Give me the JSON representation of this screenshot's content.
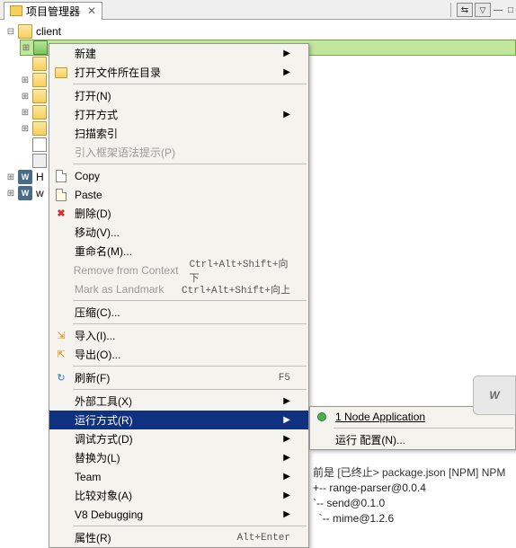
{
  "title": "项目管理器",
  "tree": {
    "root": "client",
    "bottom1": "H",
    "bottom2": "w"
  },
  "menu": {
    "new": "新建",
    "openFolder": "打开文件所在目录",
    "open": "打开(N)",
    "openWith": "打开方式",
    "scanIndex": "扫描索引",
    "importFramework": "引入框架语法提示(P)",
    "copy": "Copy",
    "paste": "Paste",
    "delete": "删除(D)",
    "move": "移动(V)...",
    "rename": "重命名(M)...",
    "removeContext": "Remove from Context",
    "removeContextAccel": "Ctrl+Alt+Shift+向下",
    "markLandmark": "Mark as Landmark",
    "markLandmarkAccel": "Ctrl+Alt+Shift+向上",
    "compress": "压缩(C)...",
    "import": "导入(I)...",
    "export": "导出(O)...",
    "refresh": "刷新(F)",
    "refreshAccel": "F5",
    "extTools": "外部工具(X)",
    "runAs": "运行方式(R)",
    "debugAs": "调试方式(D)",
    "replace": "替换为(L)",
    "team": "Team",
    "compare": "比较对象(A)",
    "v8": "V8 Debugging",
    "properties": "属性(R)",
    "propertiesAccel": "Alt+Enter"
  },
  "submenu": {
    "nodeApp": "1 Node Application",
    "runConfig": "运行 配置(N)..."
  },
  "console": {
    "header": "前是 [已终止> package.json [NPM] NPM",
    "l1": "+-- range-parser@0.0.4",
    "l2": "`-- send@0.1.0",
    "l3": "  `-- mime@1.2.6"
  },
  "watermark": "W"
}
